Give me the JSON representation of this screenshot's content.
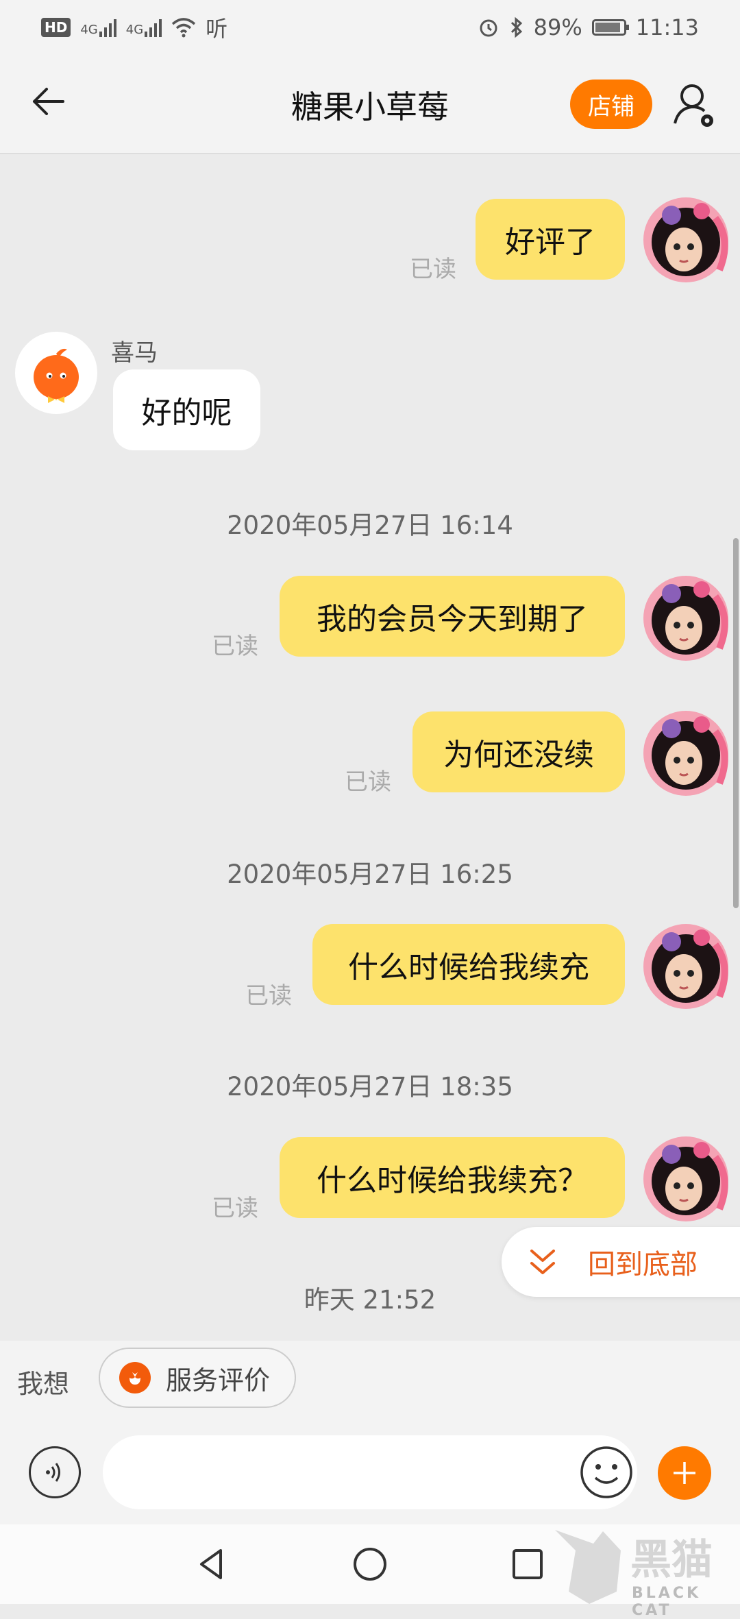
{
  "status_bar": {
    "hd": "HD",
    "network1": "4G",
    "network2": "4G",
    "extra": "听",
    "battery": "89%",
    "battery_level": 0.89,
    "time": "11:13"
  },
  "header": {
    "title": "糖果小草莓",
    "shop_label": "店铺"
  },
  "messages": [
    {
      "direction": "out",
      "text": "好评了",
      "status": "已读"
    },
    {
      "direction": "in",
      "sender": "喜马",
      "text": "好的呢"
    },
    {
      "type": "timestamp",
      "text": "2020年05月27日 16:14"
    },
    {
      "direction": "out",
      "text": "我的会员今天到期了",
      "status": "已读"
    },
    {
      "direction": "out",
      "text": "为何还没续",
      "status": "已读"
    },
    {
      "type": "timestamp",
      "text": "2020年05月27日 16:25"
    },
    {
      "direction": "out",
      "text": "什么时候给我续充",
      "status": "已读"
    },
    {
      "type": "timestamp",
      "text": "2020年05月27日 18:35"
    },
    {
      "direction": "out",
      "text": "什么时候给我续充？",
      "status": "已读"
    },
    {
      "type": "timestamp",
      "text": "昨天  21:52"
    }
  ],
  "back_to_bottom": {
    "label": "回到底部"
  },
  "suggestions": {
    "label": "我想",
    "chips": [
      {
        "label": "服务评价",
        "icon": "flower-icon"
      }
    ]
  },
  "input": {
    "placeholder": "",
    "value": ""
  },
  "watermark": {
    "text": "BLACK CAT",
    "logo": "黑猫"
  },
  "colors": {
    "accent": "#ff7a00",
    "outgoing_bubble": "#fde26c",
    "incoming_bubble": "#ffffff",
    "chat_background": "#ebebeb",
    "link": "#e8601c"
  }
}
